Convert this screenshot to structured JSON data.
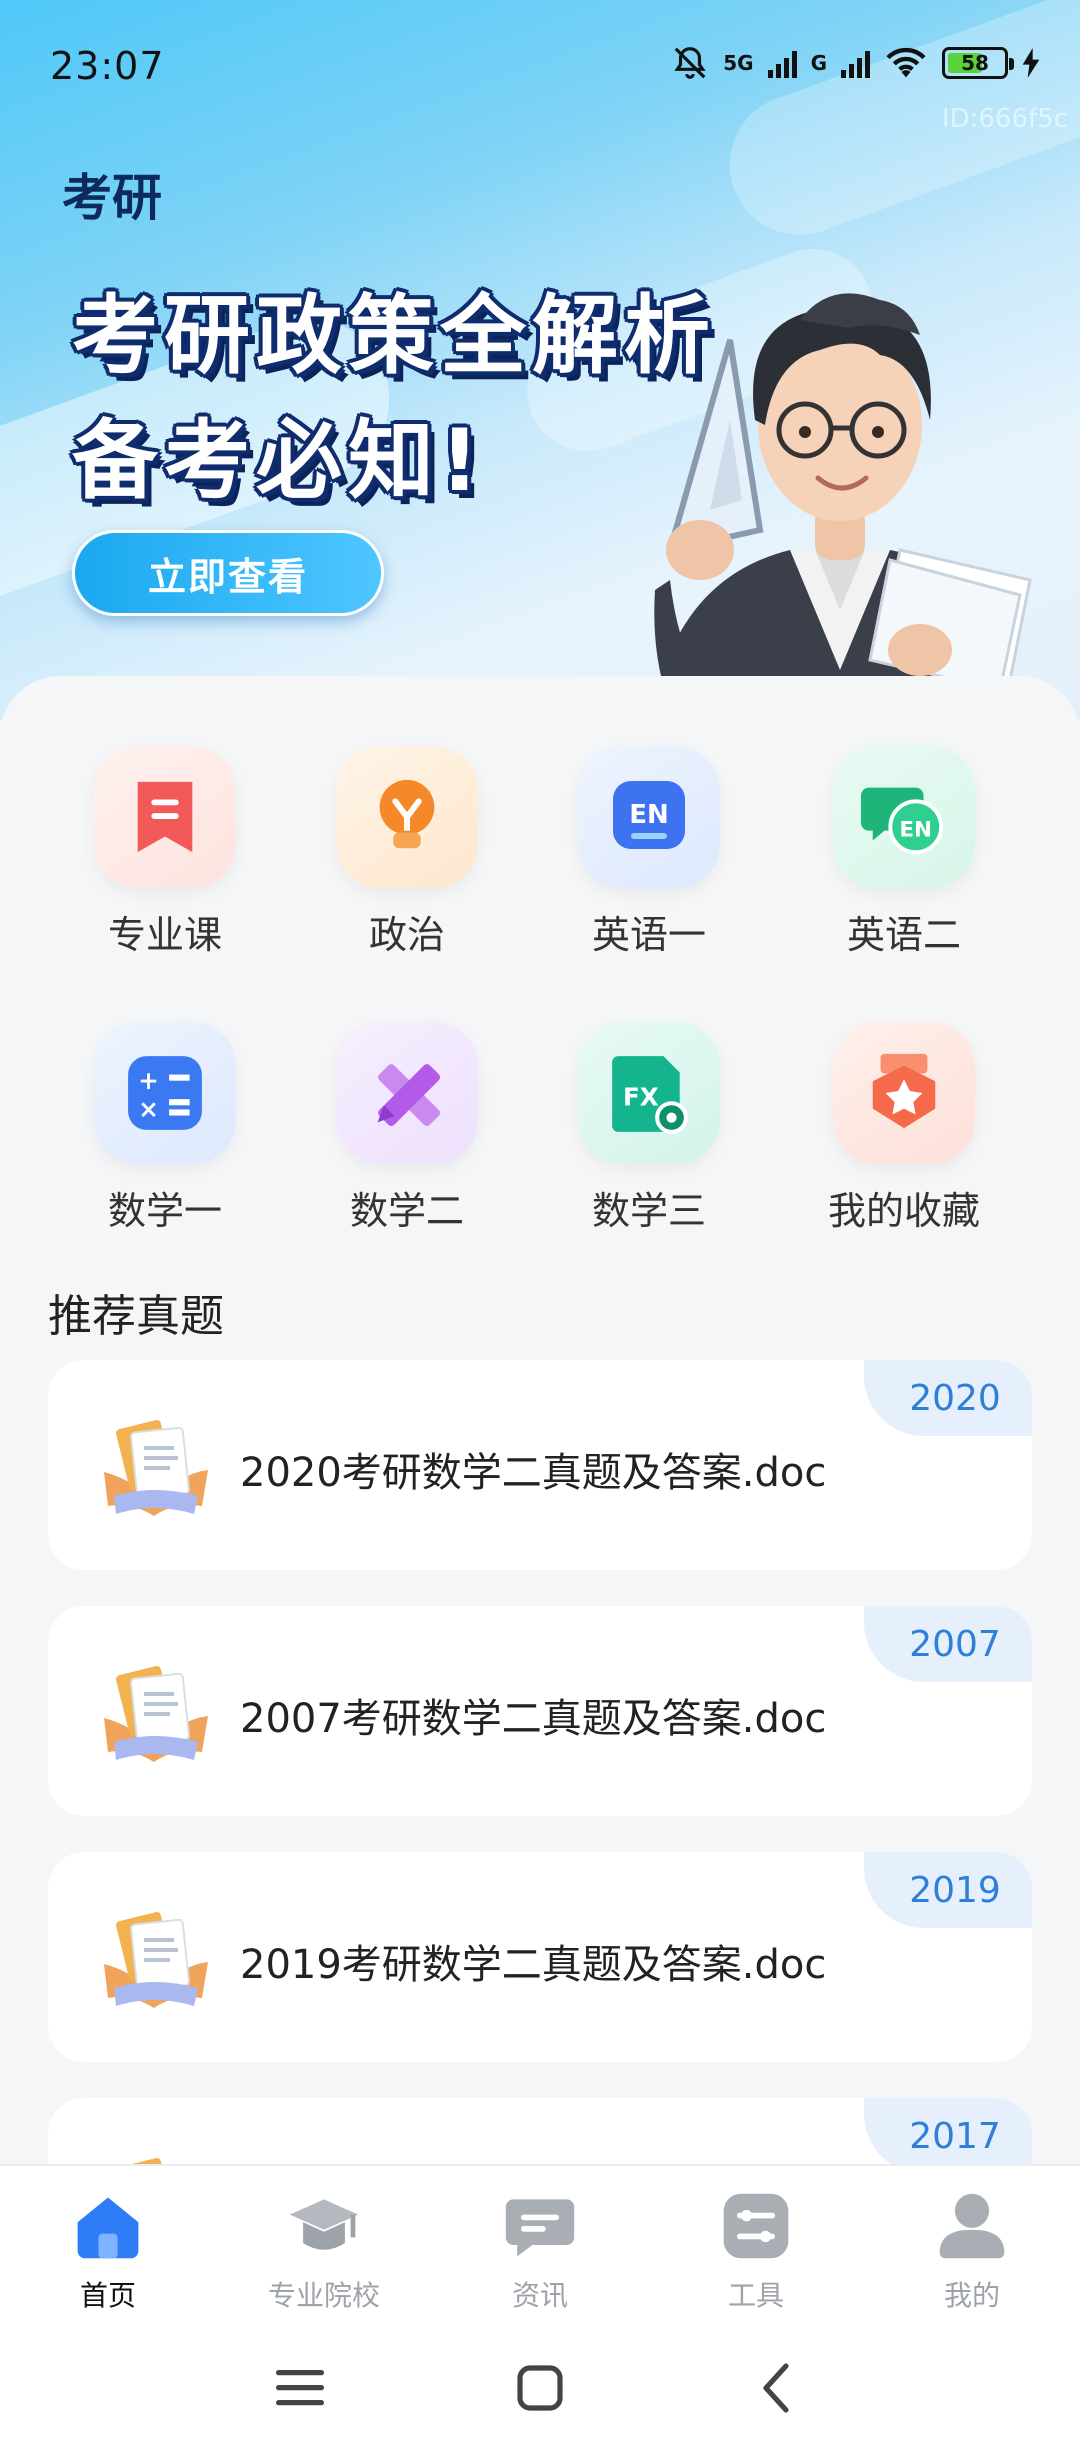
{
  "status_bar": {
    "time": "23:07",
    "network_1": "5G",
    "network_2": "G",
    "battery_level": "58",
    "id_tag": "ID:666f5c"
  },
  "banner": {
    "app_title": "考研",
    "headline_line1": "考研政策全解析",
    "headline_line2": "备考必知!",
    "cta_label": "立即查看"
  },
  "categories": [
    {
      "label": "专业课",
      "icon": "bookmark-icon",
      "color": "#f25a5a"
    },
    {
      "label": "政治",
      "icon": "lightbulb-icon",
      "color": "#f5892a"
    },
    {
      "label": "英语一",
      "icon": "en-icon",
      "color": "#3d72f0"
    },
    {
      "label": "英语二",
      "icon": "en-chat-icon",
      "color": "#1fb57a"
    },
    {
      "label": "数学一",
      "icon": "calculator-icon",
      "color": "#3b79f2"
    },
    {
      "label": "数学二",
      "icon": "ruler-pencil-icon",
      "color": "#b35ae8"
    },
    {
      "label": "数学三",
      "icon": "fx-file-icon",
      "color": "#14b58e"
    },
    {
      "label": "我的收藏",
      "icon": "star-badge-icon",
      "color": "#f46a4a"
    }
  ],
  "section_title": "推荐真题",
  "documents": [
    {
      "year": "2020",
      "name": "2020考研数学二真题及答案.doc"
    },
    {
      "year": "2007",
      "name": "2007考研数学二真题及答案.doc"
    },
    {
      "year": "2019",
      "name": "2019考研数学二真题及答案.doc"
    },
    {
      "year": "2017",
      "name": ""
    }
  ],
  "tabbar": [
    {
      "label": "首页",
      "icon": "home-icon",
      "active": true
    },
    {
      "label": "专业院校",
      "icon": "graduation-cap-icon",
      "active": false
    },
    {
      "label": "资讯",
      "icon": "message-icon",
      "active": false
    },
    {
      "label": "工具",
      "icon": "tools-icon",
      "active": false
    },
    {
      "label": "我的",
      "icon": "user-icon",
      "active": false
    }
  ],
  "colors": {
    "accent": "#2f7fd8",
    "tab_active": "#2e7cf6",
    "tab_inactive": "#9ea3aa",
    "headline_outline": "#0f2d6e"
  }
}
